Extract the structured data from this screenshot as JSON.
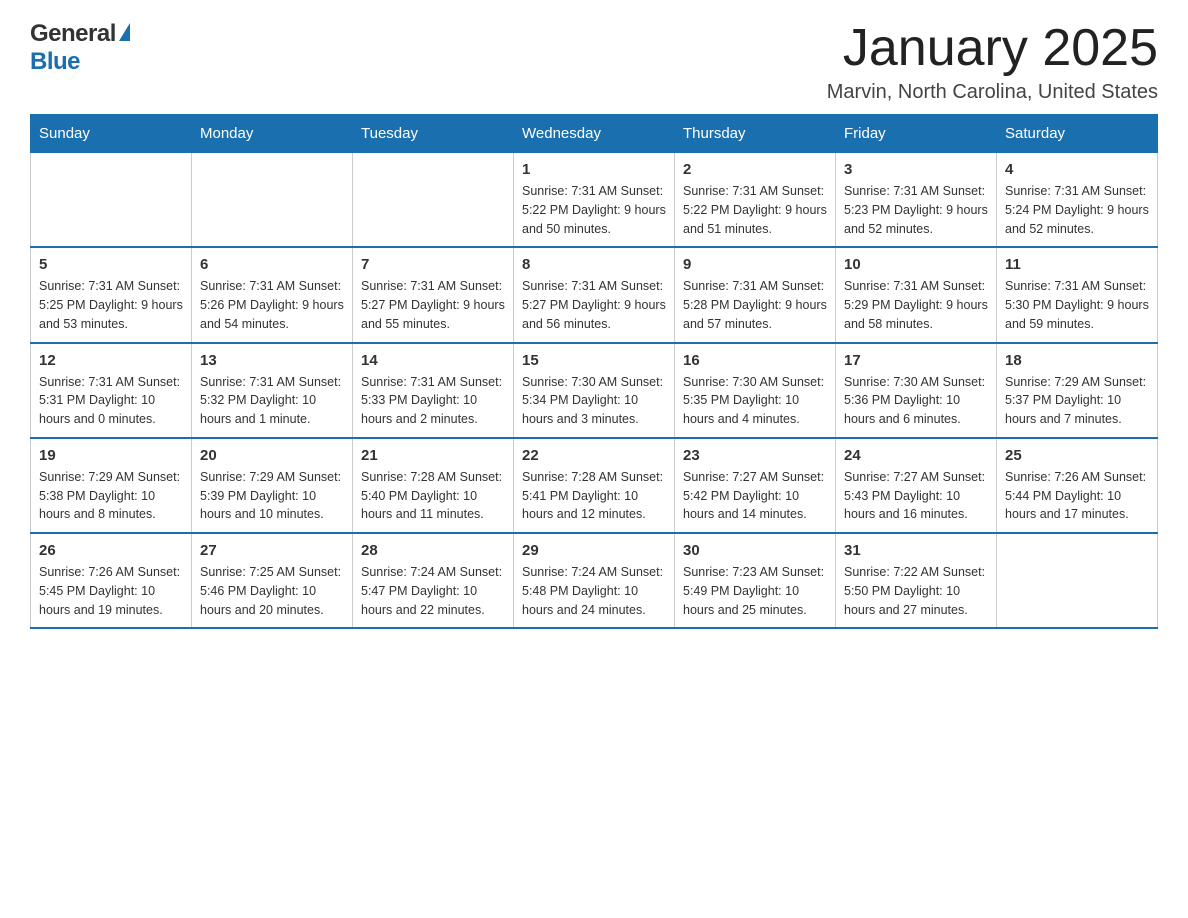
{
  "header": {
    "logo_general": "General",
    "logo_blue": "Blue",
    "month_title": "January 2025",
    "location": "Marvin, North Carolina, United States"
  },
  "calendar": {
    "days_of_week": [
      "Sunday",
      "Monday",
      "Tuesday",
      "Wednesday",
      "Thursday",
      "Friday",
      "Saturday"
    ],
    "weeks": [
      [
        {
          "day": "",
          "info": ""
        },
        {
          "day": "",
          "info": ""
        },
        {
          "day": "",
          "info": ""
        },
        {
          "day": "1",
          "info": "Sunrise: 7:31 AM\nSunset: 5:22 PM\nDaylight: 9 hours\nand 50 minutes."
        },
        {
          "day": "2",
          "info": "Sunrise: 7:31 AM\nSunset: 5:22 PM\nDaylight: 9 hours\nand 51 minutes."
        },
        {
          "day": "3",
          "info": "Sunrise: 7:31 AM\nSunset: 5:23 PM\nDaylight: 9 hours\nand 52 minutes."
        },
        {
          "day": "4",
          "info": "Sunrise: 7:31 AM\nSunset: 5:24 PM\nDaylight: 9 hours\nand 52 minutes."
        }
      ],
      [
        {
          "day": "5",
          "info": "Sunrise: 7:31 AM\nSunset: 5:25 PM\nDaylight: 9 hours\nand 53 minutes."
        },
        {
          "day": "6",
          "info": "Sunrise: 7:31 AM\nSunset: 5:26 PM\nDaylight: 9 hours\nand 54 minutes."
        },
        {
          "day": "7",
          "info": "Sunrise: 7:31 AM\nSunset: 5:27 PM\nDaylight: 9 hours\nand 55 minutes."
        },
        {
          "day": "8",
          "info": "Sunrise: 7:31 AM\nSunset: 5:27 PM\nDaylight: 9 hours\nand 56 minutes."
        },
        {
          "day": "9",
          "info": "Sunrise: 7:31 AM\nSunset: 5:28 PM\nDaylight: 9 hours\nand 57 minutes."
        },
        {
          "day": "10",
          "info": "Sunrise: 7:31 AM\nSunset: 5:29 PM\nDaylight: 9 hours\nand 58 minutes."
        },
        {
          "day": "11",
          "info": "Sunrise: 7:31 AM\nSunset: 5:30 PM\nDaylight: 9 hours\nand 59 minutes."
        }
      ],
      [
        {
          "day": "12",
          "info": "Sunrise: 7:31 AM\nSunset: 5:31 PM\nDaylight: 10 hours\nand 0 minutes."
        },
        {
          "day": "13",
          "info": "Sunrise: 7:31 AM\nSunset: 5:32 PM\nDaylight: 10 hours\nand 1 minute."
        },
        {
          "day": "14",
          "info": "Sunrise: 7:31 AM\nSunset: 5:33 PM\nDaylight: 10 hours\nand 2 minutes."
        },
        {
          "day": "15",
          "info": "Sunrise: 7:30 AM\nSunset: 5:34 PM\nDaylight: 10 hours\nand 3 minutes."
        },
        {
          "day": "16",
          "info": "Sunrise: 7:30 AM\nSunset: 5:35 PM\nDaylight: 10 hours\nand 4 minutes."
        },
        {
          "day": "17",
          "info": "Sunrise: 7:30 AM\nSunset: 5:36 PM\nDaylight: 10 hours\nand 6 minutes."
        },
        {
          "day": "18",
          "info": "Sunrise: 7:29 AM\nSunset: 5:37 PM\nDaylight: 10 hours\nand 7 minutes."
        }
      ],
      [
        {
          "day": "19",
          "info": "Sunrise: 7:29 AM\nSunset: 5:38 PM\nDaylight: 10 hours\nand 8 minutes."
        },
        {
          "day": "20",
          "info": "Sunrise: 7:29 AM\nSunset: 5:39 PM\nDaylight: 10 hours\nand 10 minutes."
        },
        {
          "day": "21",
          "info": "Sunrise: 7:28 AM\nSunset: 5:40 PM\nDaylight: 10 hours\nand 11 minutes."
        },
        {
          "day": "22",
          "info": "Sunrise: 7:28 AM\nSunset: 5:41 PM\nDaylight: 10 hours\nand 12 minutes."
        },
        {
          "day": "23",
          "info": "Sunrise: 7:27 AM\nSunset: 5:42 PM\nDaylight: 10 hours\nand 14 minutes."
        },
        {
          "day": "24",
          "info": "Sunrise: 7:27 AM\nSunset: 5:43 PM\nDaylight: 10 hours\nand 16 minutes."
        },
        {
          "day": "25",
          "info": "Sunrise: 7:26 AM\nSunset: 5:44 PM\nDaylight: 10 hours\nand 17 minutes."
        }
      ],
      [
        {
          "day": "26",
          "info": "Sunrise: 7:26 AM\nSunset: 5:45 PM\nDaylight: 10 hours\nand 19 minutes."
        },
        {
          "day": "27",
          "info": "Sunrise: 7:25 AM\nSunset: 5:46 PM\nDaylight: 10 hours\nand 20 minutes."
        },
        {
          "day": "28",
          "info": "Sunrise: 7:24 AM\nSunset: 5:47 PM\nDaylight: 10 hours\nand 22 minutes."
        },
        {
          "day": "29",
          "info": "Sunrise: 7:24 AM\nSunset: 5:48 PM\nDaylight: 10 hours\nand 24 minutes."
        },
        {
          "day": "30",
          "info": "Sunrise: 7:23 AM\nSunset: 5:49 PM\nDaylight: 10 hours\nand 25 minutes."
        },
        {
          "day": "31",
          "info": "Sunrise: 7:22 AM\nSunset: 5:50 PM\nDaylight: 10 hours\nand 27 minutes."
        },
        {
          "day": "",
          "info": ""
        }
      ]
    ]
  }
}
